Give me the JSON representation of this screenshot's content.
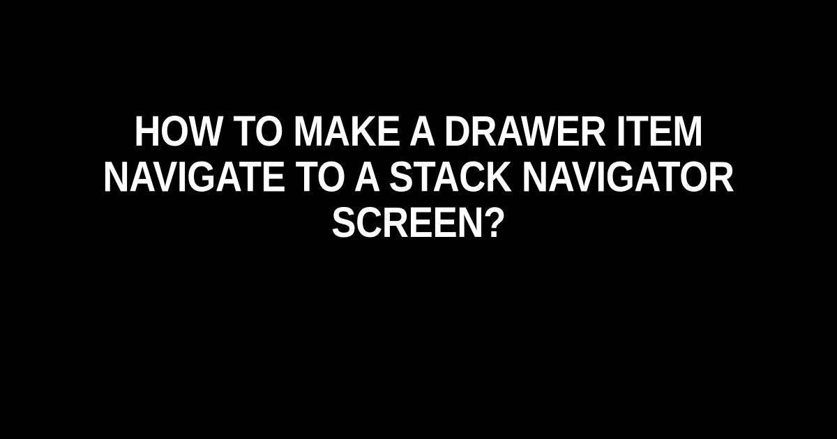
{
  "title": "How to Make a Drawer Item Navigate to a Stack Navigator Screen?"
}
